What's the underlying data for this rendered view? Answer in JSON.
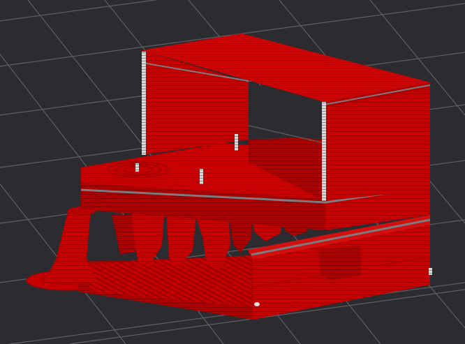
{
  "viewport": {
    "background_color": "#2b2b30",
    "grid_color": "#5f6064",
    "model": {
      "color": "#cc0000",
      "shadow_color": "#8f0000",
      "highlight_color": "#e21414",
      "seam_color": "#d8d8d8",
      "layer_line_color": "#a10000",
      "gap_color": "#7c7c80"
    }
  }
}
